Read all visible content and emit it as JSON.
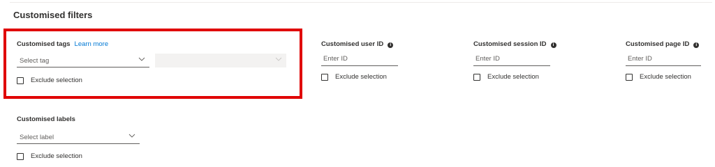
{
  "section_title": "Customised filters",
  "tags": {
    "label": "Customised tags",
    "learn_more": "Learn more",
    "select_placeholder": "Select tag",
    "exclude_label": "Exclude selection"
  },
  "user_id": {
    "label": "Customised user ID",
    "placeholder": "Enter ID",
    "exclude_label": "Exclude selection"
  },
  "session_id": {
    "label": "Customised session ID",
    "placeholder": "Enter ID",
    "exclude_label": "Exclude selection"
  },
  "page_id": {
    "label": "Customised page ID",
    "placeholder": "Enter ID",
    "exclude_label": "Exclude selection"
  },
  "labels": {
    "label": "Customised labels",
    "select_placeholder": "Select label",
    "exclude_label": "Exclude selection"
  },
  "colors": {
    "highlight": "#e00000",
    "link": "#0078d4"
  }
}
